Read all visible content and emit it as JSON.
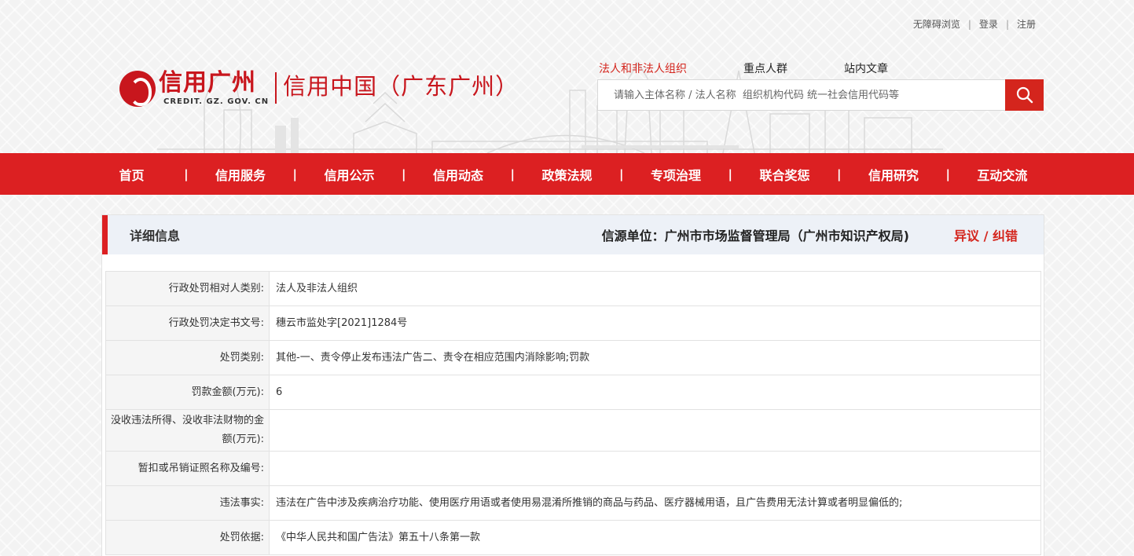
{
  "colors": {
    "brand_red": "#dc2022",
    "accent_red": "#d4251d",
    "panel_head_bg": "#edf1f7"
  },
  "toplinks": {
    "accessibility": "无障碍浏览",
    "login": "登录",
    "register": "注册",
    "separator": "|"
  },
  "logo": {
    "name": "信用广州",
    "domain": "CREDIT. GZ. GOV. CN",
    "subtitle": "信用中国（广东广州）"
  },
  "search": {
    "tabs": [
      "法人和非法人组织",
      "重点人群",
      "站内文章"
    ],
    "active_tab": "法人和非法人组织",
    "placeholder": "请输入主体名称 / 法人名称  组织机构代码 统一社会信用代码等",
    "value": "",
    "icon": "search-icon"
  },
  "nav": {
    "separator": "|",
    "items": [
      "首页",
      "信用服务",
      "信用公示",
      "信用动态",
      "政策法规",
      "专项治理",
      "联合奖惩",
      "信用研究",
      "互动交流"
    ]
  },
  "panel": {
    "title": "详细信息",
    "source": "信源单位：广州市市场监督管理局（广州市知识产权局)",
    "objection": "异议 / 纠错"
  },
  "details": [
    {
      "label": "行政处罚相对人类别:",
      "value": "法人及非法人组织"
    },
    {
      "label": "行政处罚决定书文号:",
      "value": "穗云市监处字[2021]1284号"
    },
    {
      "label": "处罚类别:",
      "value": "其他-一、责令停止发布违法广告二、责令在相应范围内消除影响;罚款"
    },
    {
      "label": "罚款金额(万元):",
      "value": "6"
    },
    {
      "label": "没收违法所得、没收非法财物的金额(万元):",
      "value": ""
    },
    {
      "label": "暂扣或吊销证照名称及编号:",
      "value": ""
    },
    {
      "label": "违法事实:",
      "value": "违法在广告中涉及疾病治疗功能、使用医疗用语或者使用易混淆所推销的商品与药品、医疗器械用语，且广告费用无法计算或者明显偏低的;"
    },
    {
      "label": "处罚依据:",
      "value": "《中华人民共和国广告法》第五十八条第一款"
    }
  ]
}
